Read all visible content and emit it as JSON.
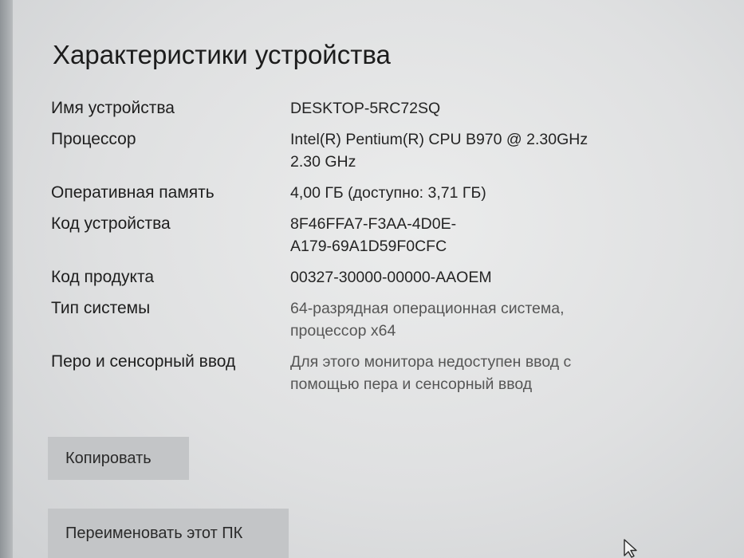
{
  "section": {
    "title": "Характеристики устройства"
  },
  "specs": [
    {
      "label": "Имя устройства",
      "value": "DESKTOP-5RC72SQ",
      "value_line2": ""
    },
    {
      "label": "Процессор",
      "value": "Intel(R) Pentium(R) CPU B970 @ 2.30GHz",
      "value_line2": "2.30 GHz"
    },
    {
      "label": "Оперативная память",
      "value": "4,00 ГБ (доступно: 3,71 ГБ)",
      "value_line2": ""
    },
    {
      "label": "Код устройства",
      "value": "8F46FFA7-F3AA-4D0E-",
      "value_line2": "A179-69A1D59F0CFC"
    },
    {
      "label": "Код продукта",
      "value": "00327-30000-00000-AAOEM",
      "value_line2": ""
    },
    {
      "label": "Тип системы",
      "value": "64-разрядная операционная система,",
      "value_line2": "процессор x64"
    },
    {
      "label": "Перо и сенсорный ввод",
      "value": "Для этого монитора недоступен ввод с",
      "value_line2": "помощью пера и сенсорный ввод"
    }
  ],
  "buttons": {
    "copy_label": "Копировать",
    "rename_label": "Переименовать этот ПК"
  },
  "colors": {
    "panel_background": "#e4e5e6",
    "button_background": "#c3c5c7",
    "text": "#1e1e1e"
  },
  "icons": {
    "cursor": "mouse-pointer-icon"
  }
}
